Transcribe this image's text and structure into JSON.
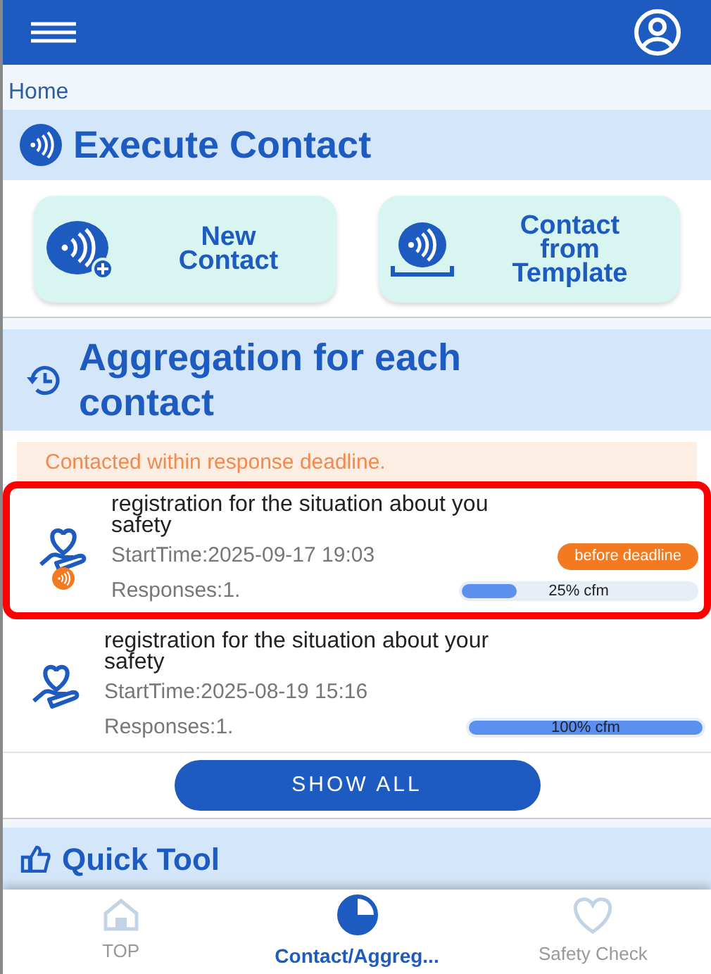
{
  "breadcrumb": "Home",
  "execute": {
    "title": "Execute Contact",
    "buttons": [
      {
        "kind": "new",
        "label": "New Contact"
      },
      {
        "kind": "template",
        "label": "Contact from Template"
      }
    ]
  },
  "aggregation": {
    "title": "Aggregation for each contact",
    "notice": "Contacted within response deadline.",
    "items": [
      {
        "title": "registration for the situation about you",
        "title_line2": "safety",
        "start": "StartTime:2025-09-17 19:03",
        "responses": "Responses:1.",
        "badge": "before deadline",
        "level": 0.25,
        "progress_label": "25% cfm",
        "highlighted": true,
        "alert": true
      },
      {
        "title": "registration for the situation about your",
        "title_line2": "safety",
        "start": "StartTime:2025-08-19 15:16",
        "responses": "Responses:1.",
        "level": 1,
        "progress_label": "100% cfm",
        "highlighted": false,
        "alert": false
      }
    ],
    "show_all": "SHOW ALL"
  },
  "quick_tool": {
    "title": "Quick Tool"
  },
  "nav": [
    {
      "kind": "home",
      "label": "TOP",
      "selected": false
    },
    {
      "kind": "chart",
      "label": "Contact/Aggreg...",
      "selected": true
    },
    {
      "kind": "heart",
      "label": "Safety Check",
      "selected": false
    }
  ]
}
